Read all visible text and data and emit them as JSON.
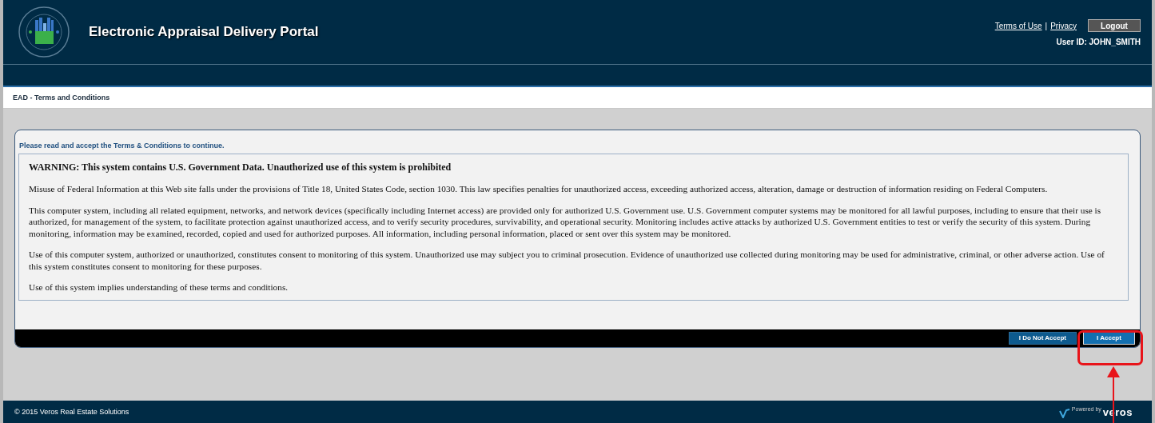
{
  "header": {
    "title": "Electronic Appraisal Delivery Portal",
    "links": [
      "Terms of Use",
      "Privacy"
    ],
    "link_separator": "|",
    "logout": "Logout",
    "user_id": "User ID: JOHN_SMITH"
  },
  "breadcrumb": "EAD - Terms and Conditions",
  "panel": {
    "intro": "Please read and accept the Terms & Conditions to continue.",
    "warning": "WARNING: This system contains U.S. Government Data. Unauthorized use of this system is prohibited",
    "paragraphs": [
      "Misuse of Federal Information at this Web site falls under the provisions of Title 18, United States Code, section 1030. This law specifies penalties for unauthorized access, exceeding authorized access, alteration, damage or destruction of information residing on Federal Computers.",
      "This computer system, including all related equipment, networks, and network devices (specifically including Internet access) are provided only for authorized U.S. Government use. U.S. Government computer systems may be monitored for all lawful purposes, including to ensure that their use is authorized, for management of the system, to facilitate protection against unauthorized access, and to verify security procedures, survivability, and operational security. Monitoring includes active attacks by authorized U.S. Government entities to test or verify the security of this system. During monitoring, information may be examined, recorded, copied and used for authorized purposes. All information, including personal information, placed or sent over this system may be monitored.",
      "Use of this computer system, authorized or unauthorized, constitutes consent to monitoring of this system. Unauthorized use may subject you to criminal prosecution. Evidence of unauthorized use collected during monitoring may be used for administrative, criminal, or other adverse action. Use of this system constitutes consent to monitoring for these purposes.",
      "Use of this system implies understanding of these terms and conditions."
    ],
    "buttons": [
      {
        "label": "I Do Not Accept",
        "highlighted": false
      },
      {
        "label": "I Accept",
        "highlighted": true
      }
    ]
  },
  "footer": {
    "copyright": "© 2015 Veros Real Estate Solutions",
    "powered_by": "Powered by",
    "brand": "veros"
  }
}
